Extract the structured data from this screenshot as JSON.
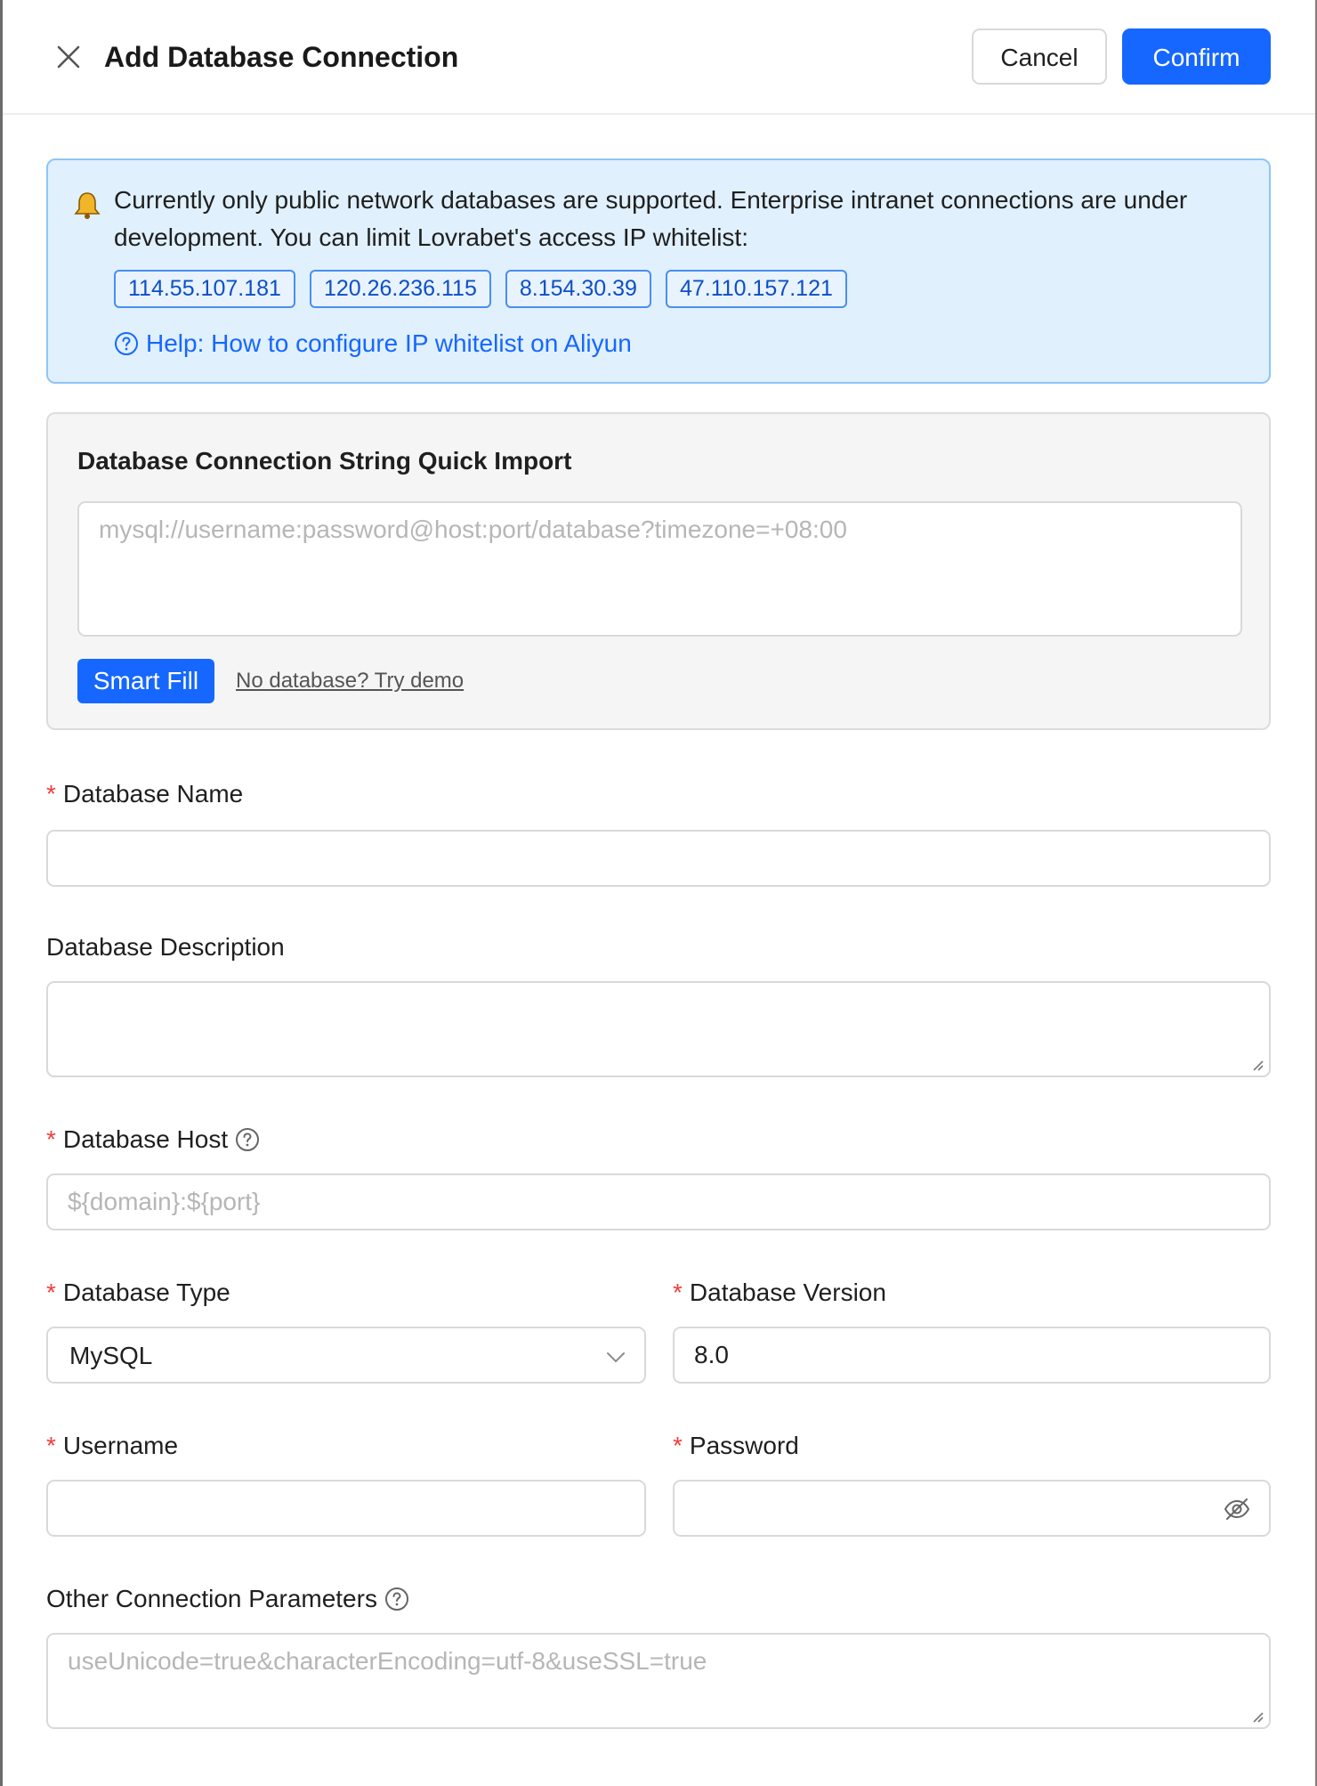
{
  "header": {
    "title": "Add Database Connection",
    "cancel_label": "Cancel",
    "confirm_label": "Confirm"
  },
  "notice": {
    "text": "Currently only public network databases are supported. Enterprise intranet connections are under development. You can limit Lovrabet's access IP whitelist:",
    "ips": [
      "114.55.107.181",
      "120.26.236.115",
      "8.154.30.39",
      "47.110.157.121"
    ],
    "help_link": "Help: How to configure IP whitelist on Aliyun"
  },
  "quick_import": {
    "title": "Database Connection String Quick Import",
    "placeholder": "mysql://username:password@host:port/database?timezone=+08:00",
    "smart_fill_label": "Smart Fill",
    "demo_link": "No database? Try demo"
  },
  "form": {
    "db_name": {
      "label": "Database Name",
      "value": ""
    },
    "db_description": {
      "label": "Database Description",
      "value": ""
    },
    "db_host": {
      "label": "Database Host",
      "placeholder": "${domain}:${port}"
    },
    "db_type": {
      "label": "Database Type",
      "value": "MySQL"
    },
    "db_version": {
      "label": "Database Version",
      "value": "8.0"
    },
    "username": {
      "label": "Username",
      "value": ""
    },
    "password": {
      "label": "Password",
      "value": ""
    },
    "other_params": {
      "label": "Other Connection Parameters",
      "placeholder": "useUnicode=true&characterEncoding=utf-8&useSSL=true"
    },
    "required_mark": "*"
  },
  "icons": {
    "close": "close-icon",
    "bell": "bell-icon",
    "help": "question-circle-icon",
    "chevron": "chevron-down-icon",
    "eye": "eye-invisible-icon"
  },
  "colors": {
    "primary": "#1667ff",
    "notice_bg": "#e0f0fd",
    "required": "#f23c3c"
  }
}
